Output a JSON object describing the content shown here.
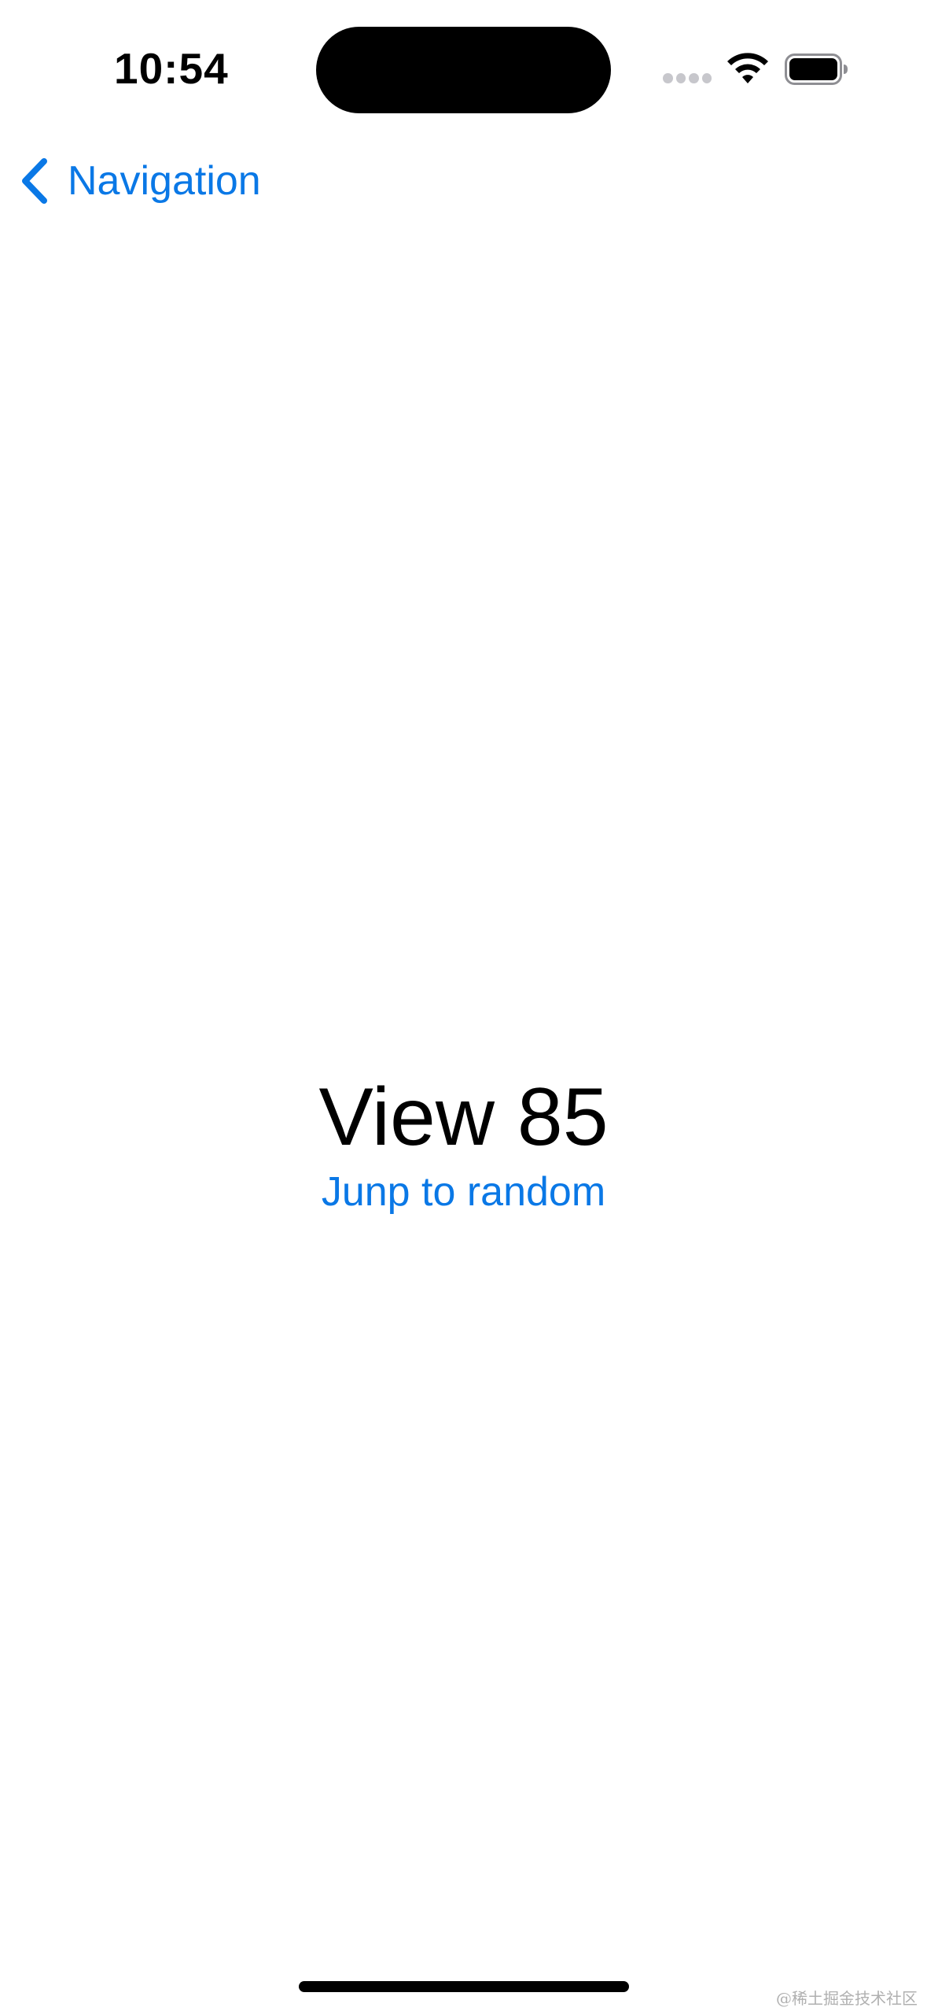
{
  "status_bar": {
    "time": "10:54",
    "icons": [
      "signal-icon",
      "wifi-icon",
      "battery-icon"
    ]
  },
  "navigation": {
    "back_label": "Navigation",
    "back_icon": "chevron-left-icon"
  },
  "main": {
    "title": "View 85",
    "link_label": "Junp to random"
  },
  "watermark": "@稀土掘金技术社区",
  "colors": {
    "accent": "#0a78e6",
    "background": "#ffffff",
    "text": "#000000"
  }
}
